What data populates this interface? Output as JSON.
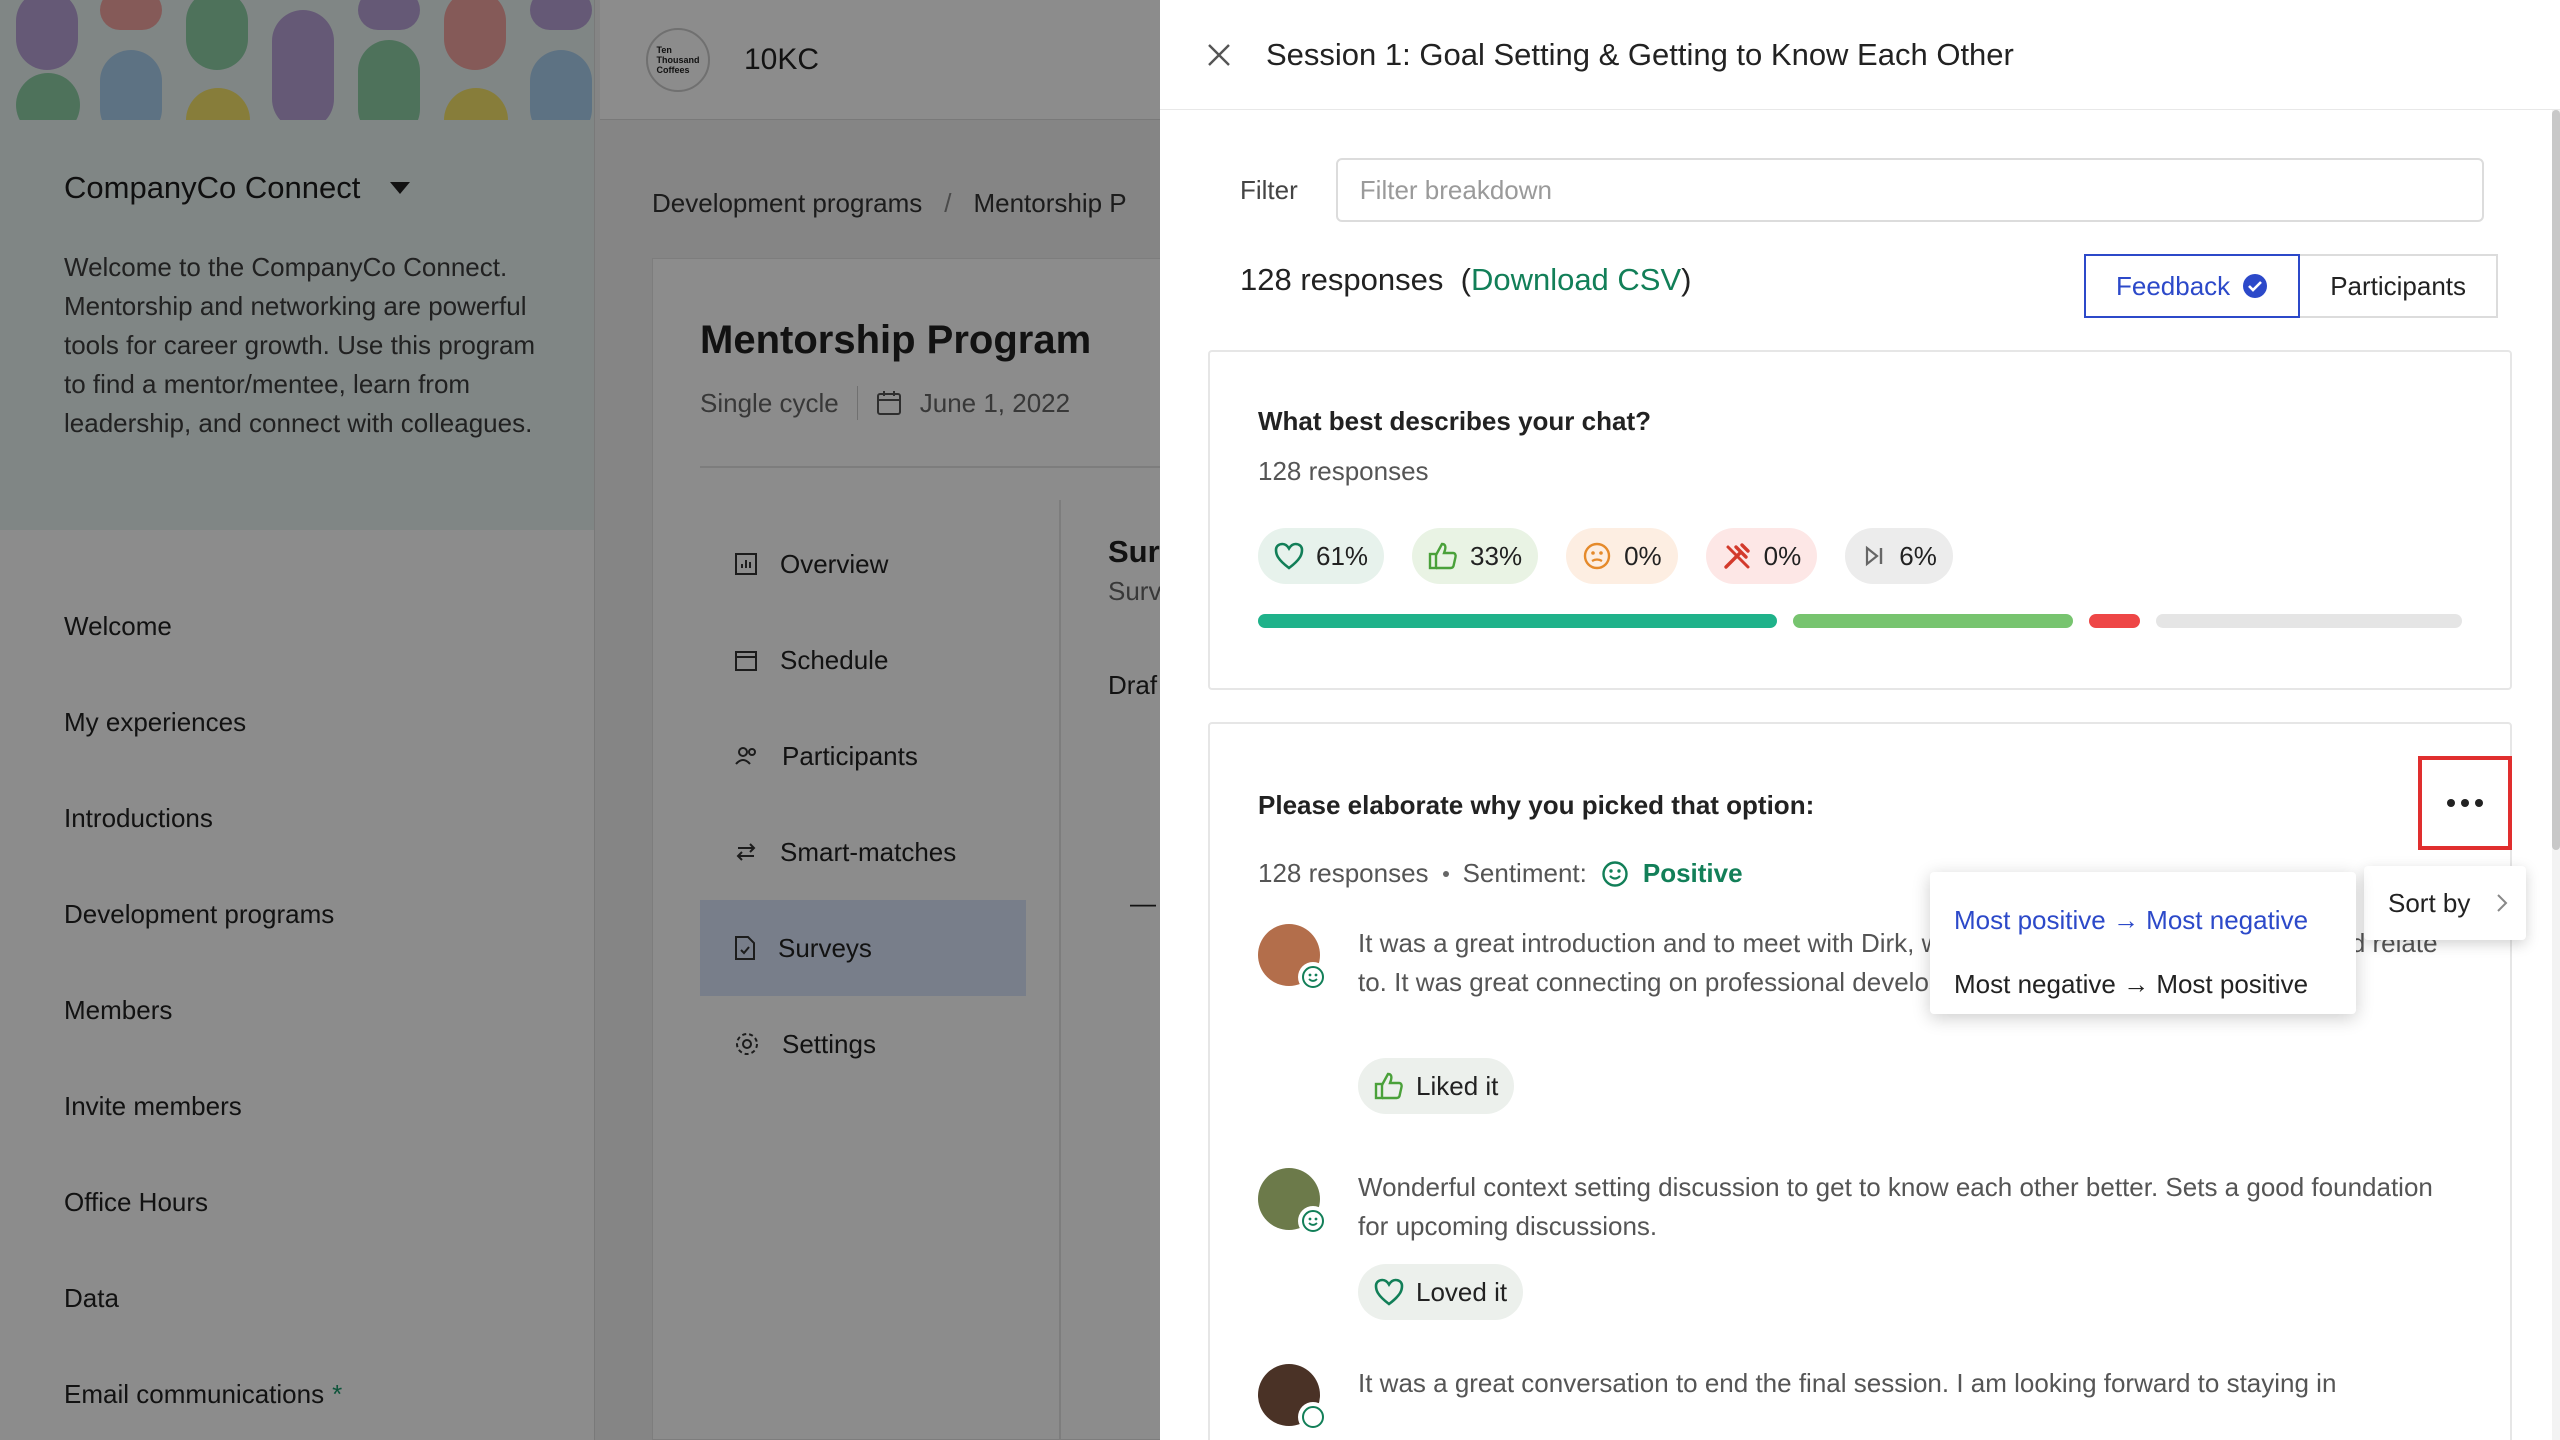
{
  "sidebar": {
    "title": "CompanyCo Connect",
    "description": "Welcome to the CompanyCo Connect. Mentorship and networking are powerful tools for career growth. Use this program to find a mentor/mentee, learn from leadership, and connect with colleagues.",
    "items": [
      {
        "label": "Welcome"
      },
      {
        "label": "My experiences"
      },
      {
        "label": "Introductions"
      },
      {
        "label": "Development programs"
      },
      {
        "label": "Members"
      },
      {
        "label": "Invite members"
      },
      {
        "label": "Office Hours"
      },
      {
        "label": "Data"
      },
      {
        "label": "Email communications",
        "required_mark": "*"
      }
    ]
  },
  "topbar": {
    "logo_text_1": "Ten",
    "logo_text_2": "Thousand",
    "logo_text_3": "Coffees",
    "brand": "10KC"
  },
  "breadcrumb": {
    "root": "Development programs",
    "separator": "/",
    "current": "Mentorship P"
  },
  "program": {
    "title": "Mentorship Program",
    "cycle": "Single cycle",
    "date": "June 1, 2022",
    "nav": [
      {
        "label": "Overview",
        "icon": "chart-icon"
      },
      {
        "label": "Schedule",
        "icon": "calendar-icon"
      },
      {
        "label": "Participants",
        "icon": "people-icon"
      },
      {
        "label": "Smart-matches",
        "icon": "swap-icon"
      },
      {
        "label": "Surveys",
        "icon": "document-icon"
      },
      {
        "label": "Settings",
        "icon": "gear-icon"
      }
    ],
    "peek_title": "Sur",
    "peek_sub": "Surv",
    "peek_tab": "Draf",
    "peek_dash": "—"
  },
  "panel": {
    "title": "Session 1: Goal Setting & Getting to Know Each Other",
    "filter_label": "Filter",
    "filter_placeholder": "Filter breakdown",
    "responses_count": "128 responses",
    "download_open": "(",
    "download_label": "Download CSV",
    "download_close": ")",
    "toggle_feedback": "Feedback",
    "toggle_participants": "Participants"
  },
  "question1": {
    "title": "What best describes your chat?",
    "subtitle": "128 responses",
    "chips": [
      {
        "icon": "heart-icon",
        "label": "61%",
        "bg": "#e7f2ec"
      },
      {
        "icon": "thumbs-up-icon",
        "label": "33%",
        "bg": "#e9f3e4"
      },
      {
        "icon": "neutral-face-icon",
        "label": "0%",
        "bg": "#fdeee2"
      },
      {
        "icon": "tools-icon",
        "label": "0%",
        "bg": "#fde7e6"
      },
      {
        "icon": "skip-icon",
        "label": "6%",
        "bg": "#ececec"
      }
    ],
    "bar_segments": [
      {
        "value": 61,
        "color": "#1fb28a"
      },
      {
        "value": 33,
        "color": "#77c46f"
      },
      {
        "value": 6,
        "color": "#ee4646"
      },
      {
        "value": 36,
        "color": "#e5e5e5"
      }
    ]
  },
  "question2": {
    "title": "Please elaborate why you picked that option:",
    "responses": "128 responses",
    "sentiment_label": "Sentiment:",
    "sentiment_value": "Positive",
    "comments": [
      {
        "text": "It was a great introduction and to meet with Dirk, we had so much in common and could relate to. It was great connecting on professional development. Dirk is a great match!",
        "chip_icon": "thumbs-up-icon",
        "chip": "Liked it"
      },
      {
        "text": "Wonderful context setting discussion to get to know each other better. Sets a good foundation for upcoming discussions.",
        "chip_icon": "heart-icon",
        "chip": "Loved it"
      },
      {
        "text": "It was a great conversation to end the final session. I am looking forward to staying in"
      }
    ]
  },
  "sort_menu": {
    "sort_by": "Sort by",
    "options": [
      {
        "label": "Most positive → Most negative",
        "selected": true
      },
      {
        "label": "Most negative → Most positive",
        "selected": false
      }
    ]
  },
  "colors": {
    "accent": "#2c49c9",
    "positive": "#127f58",
    "highlight": "#e02e2e"
  }
}
